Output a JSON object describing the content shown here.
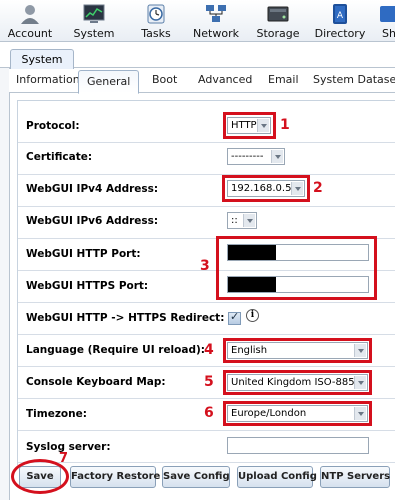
{
  "toolbar": [
    {
      "label": "Account",
      "icon": "account-icon"
    },
    {
      "label": "System",
      "icon": "system-icon"
    },
    {
      "label": "Tasks",
      "icon": "tasks-icon"
    },
    {
      "label": "Network",
      "icon": "network-icon"
    },
    {
      "label": "Storage",
      "icon": "storage-icon"
    },
    {
      "label": "Directory",
      "icon": "directory-icon"
    },
    {
      "label": "Sh",
      "icon": "sharing-icon"
    }
  ],
  "main_tab": "System",
  "sub_tabs": [
    "Information",
    "General",
    "Boot",
    "Advanced",
    "Email",
    "System Dataset"
  ],
  "active_sub_tab": "General",
  "form": {
    "protocol": {
      "label": "Protocol:",
      "value": "HTTP"
    },
    "certificate": {
      "label": "Certificate:",
      "value": "---------"
    },
    "ipv4": {
      "label": "WebGUI IPv4 Address:",
      "value": "192.168.0.5"
    },
    "ipv6": {
      "label": "WebGUI IPv6 Address:",
      "value": "::"
    },
    "http_port": {
      "label": "WebGUI HTTP Port:"
    },
    "https_port": {
      "label": "WebGUI HTTPS Port:"
    },
    "redirect": {
      "label": "WebGUI HTTP -> HTTPS Redirect:",
      "checked": true,
      "info": "i"
    },
    "language": {
      "label": "Language (Require UI reload):",
      "value": "English"
    },
    "keyboard": {
      "label": "Console Keyboard Map:",
      "value": "United Kingdom ISO-885"
    },
    "timezone": {
      "label": "Timezone:",
      "value": "Europe/London"
    },
    "syslog": {
      "label": "Syslog server:",
      "value": ""
    }
  },
  "annotations": [
    "1",
    "2",
    "3",
    "4",
    "5",
    "6",
    "7"
  ],
  "buttons": {
    "save": "Save",
    "factory_restore": "Factory Restore",
    "save_config": "Save Config",
    "upload_config": "Upload Config",
    "ntp_servers": "NTP Servers"
  },
  "colors": {
    "annotation_red": "#d4101d",
    "tab_border": "#b9c4d0"
  }
}
